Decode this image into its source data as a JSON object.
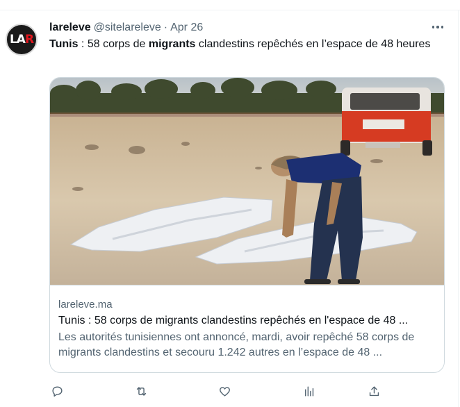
{
  "tweet": {
    "display_name": "lareleve",
    "handle": "@sitelareleve",
    "separator": "·",
    "date": "Apr 26",
    "text_part1": "Tunis",
    "text_part2": " : 58 corps de ",
    "text_part3": "migrants",
    "text_part4": " clandestins repêchés en l’espace de 48 heures"
  },
  "avatar": {
    "logo_text": "LAR",
    "colors": {
      "background": "#1a1a1a",
      "letters": "#ffffff",
      "accent": "#e0161e"
    }
  },
  "link_card": {
    "domain": "lareleve.ma",
    "title": "Tunis : 58 corps de migrants clandestins repêchés en l'espace de 48 ...",
    "description": "Les autorités tunisiennes ont annoncé, mardi, avoir repêché 58 corps de migrants clandestins et secouru 1.242 autres en l’espace de 48 ...",
    "image_description": "Man bending over white body bags on a sandy beach, red ambulance in the background"
  },
  "actions": {
    "icons": [
      "reply-icon",
      "retweet-icon",
      "like-icon",
      "views-icon",
      "share-icon"
    ]
  },
  "colors": {
    "text_primary": "#0f1419",
    "text_secondary": "#536471",
    "border": "#cfd9de"
  }
}
